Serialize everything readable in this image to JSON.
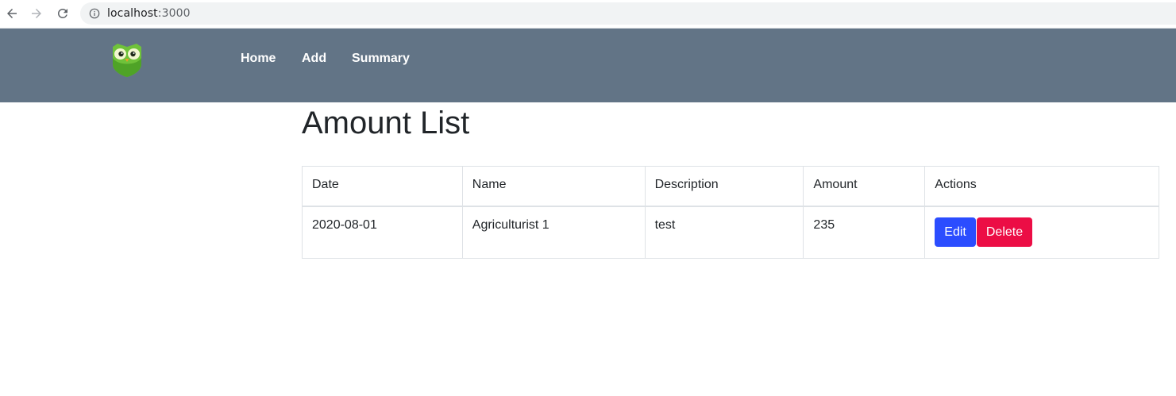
{
  "browser": {
    "url_host": "localhost",
    "url_port": ":3000",
    "icons": [
      "back-arrow-icon",
      "forward-arrow-icon",
      "reload-icon",
      "info-icon"
    ]
  },
  "navbar": {
    "logo": "owl-logo",
    "links": [
      {
        "label": "Home"
      },
      {
        "label": "Add"
      },
      {
        "label": "Summary"
      }
    ],
    "background": "#627486"
  },
  "page": {
    "title": "Amount List"
  },
  "table": {
    "columns": [
      "Date",
      "Name",
      "Description",
      "Amount",
      "Actions"
    ],
    "rows": [
      {
        "date": "2020-08-01",
        "name": "Agriculturist 1",
        "description": "test",
        "amount": "235",
        "actions": {
          "edit_label": "Edit",
          "delete_label": "Delete"
        }
      }
    ]
  },
  "colors": {
    "edit_button": "#2b4dff",
    "delete_button": "#ec0d45"
  }
}
